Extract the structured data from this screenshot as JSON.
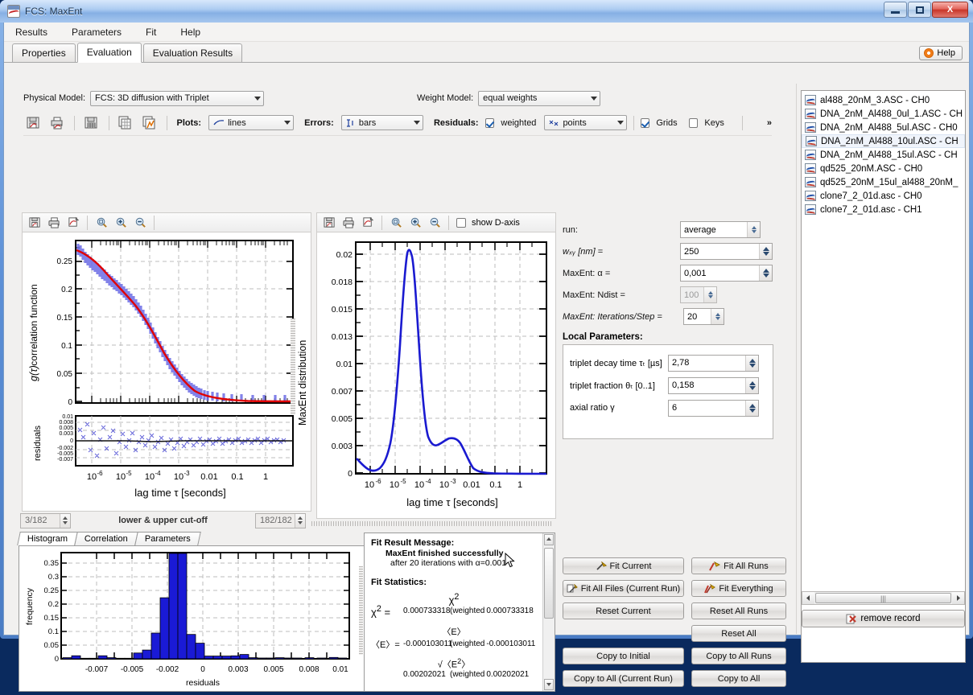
{
  "window": {
    "title": "FCS: MaxEnt",
    "minimize_label": "minimize",
    "maximize_label": "maximize",
    "close_label": "X"
  },
  "menu": {
    "items": [
      "Results",
      "Parameters",
      "Fit",
      "Help"
    ]
  },
  "tabs": {
    "items": [
      {
        "label": "Properties",
        "active": false
      },
      {
        "label": "Evaluation",
        "active": true
      },
      {
        "label": "Evaluation Results",
        "active": false
      }
    ],
    "help_label": "Help"
  },
  "model_row": {
    "physical_model_label": "Physical Model:",
    "physical_model_value": "FCS: 3D diffusion with Triplet",
    "weight_model_label": "Weight Model:",
    "weight_model_value": "equal weights"
  },
  "toolbar": {
    "plots_label": "Plots:",
    "plots_value": "lines",
    "errors_label": "Errors:",
    "errors_value": "bars",
    "residuals_label": "Residuals:",
    "weighted_label": "weighted",
    "weighted_checked": true,
    "residuals_style_value": "points",
    "grids_label": "Grids",
    "grids_checked": true,
    "keys_label": "Keys",
    "keys_checked": false,
    "overflow_label": "»",
    "icons": [
      "save-plot-icon",
      "print-plot-icon",
      "copy-plot-icon",
      "save-data-icon",
      "export-data-icon"
    ]
  },
  "left_plot": {
    "toolbar_icons": [
      "save-icon",
      "print-icon",
      "copy-icon",
      "zoom-all-icon",
      "zoom-in-icon",
      "zoom-out-icon"
    ],
    "ylabel": "correlation function g(τ)",
    "residuals_ylabel": "residuals",
    "xlabel": "lag time τ [seconds]",
    "right_label": "MaxEnt distribution",
    "cutoff_lower": "3/182",
    "cutoff_upper": "182/182",
    "cutoff_label": "lower & upper cut-off"
  },
  "right_plot": {
    "toolbar_icons": [
      "print-icon",
      "copy-icon",
      "zoom-all-icon",
      "zoom-in-icon",
      "zoom-out-icon"
    ],
    "show_daxis_label": "show D-axis",
    "show_daxis_checked": false,
    "xlabel": "lag time τ [seconds]"
  },
  "bottom_tabs": {
    "items": [
      {
        "label": "Histogram",
        "active": true
      },
      {
        "label": "Correlation",
        "active": false
      },
      {
        "label": "Parameters",
        "active": false
      }
    ]
  },
  "fit_result": {
    "message_header": "Fit Result Message:",
    "message_line1": "MaxEnt finished successfully",
    "message_line2": "after 20 iterations with α=0.001",
    "stats_header": "Fit Statistics:",
    "rows": [
      {
        "symbol": "χ²",
        "value": "0.000733318",
        "weighted_symbol": "χ² (weighted)",
        "weighted_value": "0.000733318"
      },
      {
        "symbol": "〈E〉",
        "value": "-0.000103011",
        "weighted_symbol": "〈E〉 (weighted)",
        "weighted_value": "-0.000103011"
      },
      {
        "symbol": "√〈E²〉",
        "value": "0.00202021",
        "weighted_symbol": "√〈E²〉 (weighted)",
        "weighted_value": "0.00202021"
      }
    ]
  },
  "parameters": {
    "run_label": "run:",
    "run_value": "average",
    "wxy_label": "wₓᵧ [nm]  =",
    "wxy_value": "250",
    "alpha_label": "MaxEnt: α =",
    "alpha_value": "0,001",
    "ndist_label": "MaxEnt: Ndist =",
    "ndist_value": "100",
    "iter_label": "MaxEnt: Iterations/Step =",
    "iter_value": "20",
    "local_header": "Local Parameters:",
    "local": [
      {
        "label": "triplet decay time τₜ [µs]",
        "value": "2,78"
      },
      {
        "label": "triplet fraction θₜ [0..1]",
        "value": "0,158"
      },
      {
        "label": "axial ratio γ",
        "value": "6"
      }
    ]
  },
  "fit_buttons": {
    "rows": [
      [
        {
          "label": "Fit Current",
          "icon": "fit-icon"
        },
        {
          "label": "Fit All Runs",
          "icon": "fit-all-icon"
        }
      ],
      [
        {
          "label": "Fit All Files (Current Run)",
          "icon": "fit-files-icon"
        },
        {
          "label": "Fit Everything",
          "icon": "fit-everything-icon"
        }
      ],
      [
        {
          "label": "Reset Current",
          "icon": ""
        },
        {
          "label": "Reset All Runs",
          "icon": ""
        }
      ],
      [
        {
          "label": "",
          "icon": ""
        },
        {
          "label": "Reset All",
          "icon": ""
        }
      ],
      [
        {
          "label": "Copy to Initial",
          "icon": ""
        },
        {
          "label": "Copy to All Runs",
          "icon": ""
        }
      ],
      [
        {
          "label": "Copy to All (Current Run)",
          "icon": ""
        },
        {
          "label": "Copy to All",
          "icon": ""
        }
      ]
    ]
  },
  "file_list": {
    "items": [
      {
        "label": "al488_20nM_3.ASC - CH0",
        "selected": false
      },
      {
        "label": "DNA_2nM_Al488_0ul_1.ASC - CH",
        "selected": false
      },
      {
        "label": "DNA_2nM_Al488_5ul.ASC - CH0",
        "selected": false
      },
      {
        "label": "DNA_2nM_Al488_10ul.ASC - CH",
        "selected": true
      },
      {
        "label": "DNA_2nM_Al488_15ul.ASC - CH",
        "selected": false
      },
      {
        "label": "qd525_20nM.ASC - CH0",
        "selected": false
      },
      {
        "label": "qd525_20nM_15ul_al488_20nM_",
        "selected": false
      },
      {
        "label": "clone7_2_01d.asc - CH0",
        "selected": false
      },
      {
        "label": "clone7_2_01d.asc - CH1",
        "selected": false
      }
    ],
    "remove_label": "remove record"
  },
  "chart_data": [
    {
      "type": "line",
      "name": "correlation-function",
      "title": "",
      "xlabel": "lag time τ [seconds]",
      "ylabel": "correlation function g(τ)",
      "xscale": "log",
      "xlim": [
        3e-07,
        10
      ],
      "ylim": [
        0,
        0.285
      ],
      "xticks": [
        "10⁻⁶",
        "10⁻⁵",
        "10⁻⁴",
        "10⁻³",
        "0.01",
        "0.1",
        "1"
      ],
      "yticks": [
        0,
        0.05,
        0.1,
        0.15,
        0.2,
        0.25
      ],
      "grid": true,
      "series": [
        {
          "name": "data",
          "color": "#6a6ae0",
          "style": "errorbars"
        },
        {
          "name": "fit",
          "color": "#e00000",
          "style": "line"
        }
      ],
      "fit_points": [
        [
          3e-07,
          0.272
        ],
        [
          6e-07,
          0.268
        ],
        [
          1e-06,
          0.262
        ],
        [
          2e-06,
          0.25
        ],
        [
          4e-06,
          0.232
        ],
        [
          7e-06,
          0.215
        ],
        [
          1e-05,
          0.203
        ],
        [
          2e-05,
          0.182
        ],
        [
          4e-05,
          0.155
        ],
        [
          7e-05,
          0.128
        ],
        [
          0.0001,
          0.112
        ],
        [
          0.0002,
          0.08
        ],
        [
          0.0004,
          0.05
        ],
        [
          0.0007,
          0.031
        ],
        [
          0.001,
          0.023
        ],
        [
          0.002,
          0.011
        ],
        [
          0.004,
          0.004
        ],
        [
          0.007,
          0.002
        ],
        [
          0.01,
          0.001
        ],
        [
          0.1,
          0.0
        ],
        [
          1,
          0.0
        ],
        [
          10,
          0.0
        ]
      ]
    },
    {
      "type": "scatter",
      "name": "residuals",
      "xlabel": "lag time τ [seconds]",
      "ylabel": "residuals",
      "xscale": "log",
      "xlim": [
        3e-07,
        10
      ],
      "ylim": [
        -0.007,
        0.01
      ],
      "yticks": [
        0.01,
        0.008,
        0.005,
        0.003,
        0,
        -0.002,
        -0.005,
        -0.007
      ],
      "grid": true,
      "marker": "x",
      "color": "#3a3ad0"
    },
    {
      "type": "line",
      "name": "maxent-distribution",
      "xlabel": "lag time τ [seconds]",
      "ylabel": "MaxEnt distribution",
      "xscale": "log",
      "xlim": [
        3e-07,
        10
      ],
      "ylim": [
        0,
        0.0212
      ],
      "xticks": [
        "10⁻⁶",
        "10⁻⁵",
        "10⁻⁴",
        "10⁻³",
        "0.01",
        "0.1",
        "1"
      ],
      "yticks": [
        0,
        0.003,
        0.005,
        0.007,
        0.01,
        0.013,
        0.015,
        0.018,
        0.02
      ],
      "grid": true,
      "color": "#1a1ad0",
      "points": [
        [
          3e-07,
          0.0013
        ],
        [
          6e-07,
          0.0009
        ],
        [
          1e-06,
          0.0006
        ],
        [
          2e-06,
          0.0004
        ],
        [
          3e-06,
          0.00035
        ],
        [
          5e-06,
          0.0006
        ],
        [
          8e-06,
          0.0014
        ],
        [
          1.2e-05,
          0.003
        ],
        [
          1.7e-05,
          0.0065
        ],
        [
          2.4e-05,
          0.0115
        ],
        [
          3.2e-05,
          0.0168
        ],
        [
          4e-05,
          0.0202
        ],
        [
          4.6e-05,
          0.0207
        ],
        [
          5.5e-05,
          0.019
        ],
        [
          7e-05,
          0.014
        ],
        [
          9e-05,
          0.0085
        ],
        [
          0.00012,
          0.0046
        ],
        [
          0.00016,
          0.0029
        ],
        [
          0.00022,
          0.0022
        ],
        [
          0.0003,
          0.0021
        ],
        [
          0.0005,
          0.0023
        ],
        [
          0.0008,
          0.00255
        ],
        [
          0.0011,
          0.0026
        ],
        [
          0.0016,
          0.0023
        ],
        [
          0.0024,
          0.0015
        ],
        [
          0.0035,
          0.0007
        ],
        [
          0.005,
          0.0002
        ],
        [
          0.008,
          5e-05
        ],
        [
          0.02,
          0.0
        ],
        [
          0.1,
          0.0
        ],
        [
          1,
          0.0
        ],
        [
          10,
          0.0
        ]
      ]
    },
    {
      "type": "bar",
      "name": "residual-histogram",
      "xlabel": "residuals",
      "ylabel": "frequency",
      "xticks": [
        "-0.007",
        "-0.005",
        "-0.002",
        "0",
        "0.003",
        "0.005",
        "0.008",
        "0.01"
      ],
      "yticks": [
        0,
        0.05,
        0.1,
        0.15,
        0.2,
        0.25,
        0.3,
        0.35
      ],
      "ylim": [
        0,
        0.39
      ],
      "grid": true,
      "color": "#1a1ad6",
      "categories": [
        -0.0073,
        -0.0068,
        -0.0063,
        -0.0058,
        -0.0053,
        -0.0048,
        -0.0043,
        -0.0038,
        -0.0033,
        -0.0028,
        -0.0023,
        -0.0018,
        -0.0013,
        -0.0008,
        -0.0003,
        0.0002,
        0.0007,
        0.0012,
        0.0017,
        0.0022,
        0.0027,
        0.0032,
        0.0037,
        0.0042,
        0.0047,
        0.0052,
        0.0057,
        0.0067,
        0.0077,
        0.0087,
        0.0097
      ],
      "values": [
        0.004,
        0.011,
        0.002,
        0.002,
        0.011,
        0.004,
        0.002,
        0.002,
        0.021,
        0.032,
        0.094,
        0.223,
        0.385,
        0.385,
        0.089,
        0.057,
        0.01,
        0.01,
        0.01,
        0.011,
        0.016,
        0.004,
        0.003,
        0.003,
        0.004,
        0.003,
        0.003,
        0.004,
        0.003,
        0.005,
        0.003
      ]
    }
  ]
}
